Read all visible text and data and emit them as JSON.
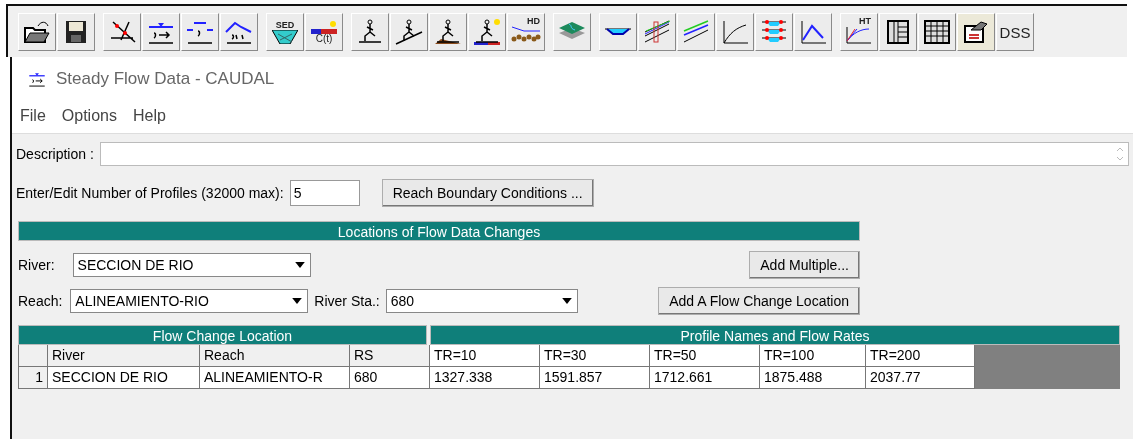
{
  "toolbar": [
    {
      "kind": "open"
    },
    {
      "kind": "save"
    },
    {
      "kind": "sep"
    },
    {
      "kind": "geometry"
    },
    {
      "kind": "steady"
    },
    {
      "kind": "quasi"
    },
    {
      "kind": "unsteady"
    },
    {
      "kind": "sep"
    },
    {
      "kind": "sediment",
      "label": "SED"
    },
    {
      "kind": "quality",
      "label": "C(t)"
    },
    {
      "kind": "sep"
    },
    {
      "kind": "person"
    },
    {
      "kind": "person-slope"
    },
    {
      "kind": "person-sediment"
    },
    {
      "kind": "person-quality"
    },
    {
      "kind": "hydro",
      "label": "HD"
    },
    {
      "kind": "sep"
    },
    {
      "kind": "layers"
    },
    {
      "kind": "sep"
    },
    {
      "kind": "xs"
    },
    {
      "kind": "profile"
    },
    {
      "kind": "lines"
    },
    {
      "kind": "curve"
    },
    {
      "kind": "stack"
    },
    {
      "kind": "peak"
    },
    {
      "kind": "sep"
    },
    {
      "kind": "ht",
      "label": "HT"
    },
    {
      "kind": "table-cols"
    },
    {
      "kind": "table-grid"
    },
    {
      "kind": "report"
    },
    {
      "kind": "text",
      "label": "DSS"
    }
  ],
  "window": {
    "title": "Steady Flow Data - CAUDAL"
  },
  "menu": [
    "File",
    "Options",
    "Help"
  ],
  "description": {
    "label": "Description :"
  },
  "profiles": {
    "label": "Enter/Edit Number of Profiles (32000 max):",
    "value": "5",
    "button": "Reach Boundary Conditions ..."
  },
  "locations": {
    "title": "Locations of Flow Data Changes",
    "river": {
      "label": "River:",
      "value": "SECCION DE RIO"
    },
    "reach": {
      "label": "Reach:",
      "value": "ALINEAMIENTO-RIO"
    },
    "river_sta": {
      "label": "River Sta.:",
      "value": "680"
    },
    "add_multiple": "Add Multiple...",
    "add_location": "Add A Flow Change Location"
  },
  "table": {
    "group_left": "Flow Change Location",
    "group_right": "Profile Names and Flow Rates",
    "columns": [
      "River",
      "Reach",
      "RS",
      "TR=10",
      "TR=30",
      "TR=50",
      "TR=100",
      "TR=200"
    ],
    "rows": [
      {
        "number": "1",
        "cells": [
          "SECCION DE RIO",
          "ALINEAMIENTO-R",
          "680",
          "1327.338",
          "1591.857",
          "1712.661",
          "1875.488",
          "2037.77"
        ]
      }
    ]
  }
}
